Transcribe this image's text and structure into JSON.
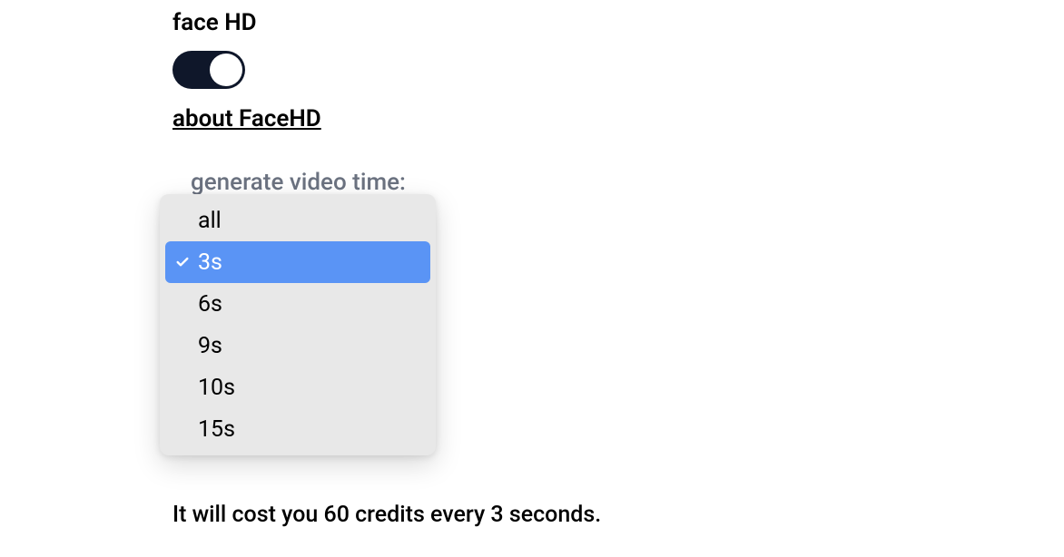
{
  "faceHd": {
    "label": "face HD",
    "toggleOn": true,
    "aboutLink": "about FaceHD"
  },
  "videoTime": {
    "label": "generate video time:",
    "options": [
      "all",
      "3s",
      "6s",
      "9s",
      "10s",
      "15s"
    ],
    "selectedIndex": 1
  },
  "costText": "It will cost you 60 credits every 3 seconds."
}
